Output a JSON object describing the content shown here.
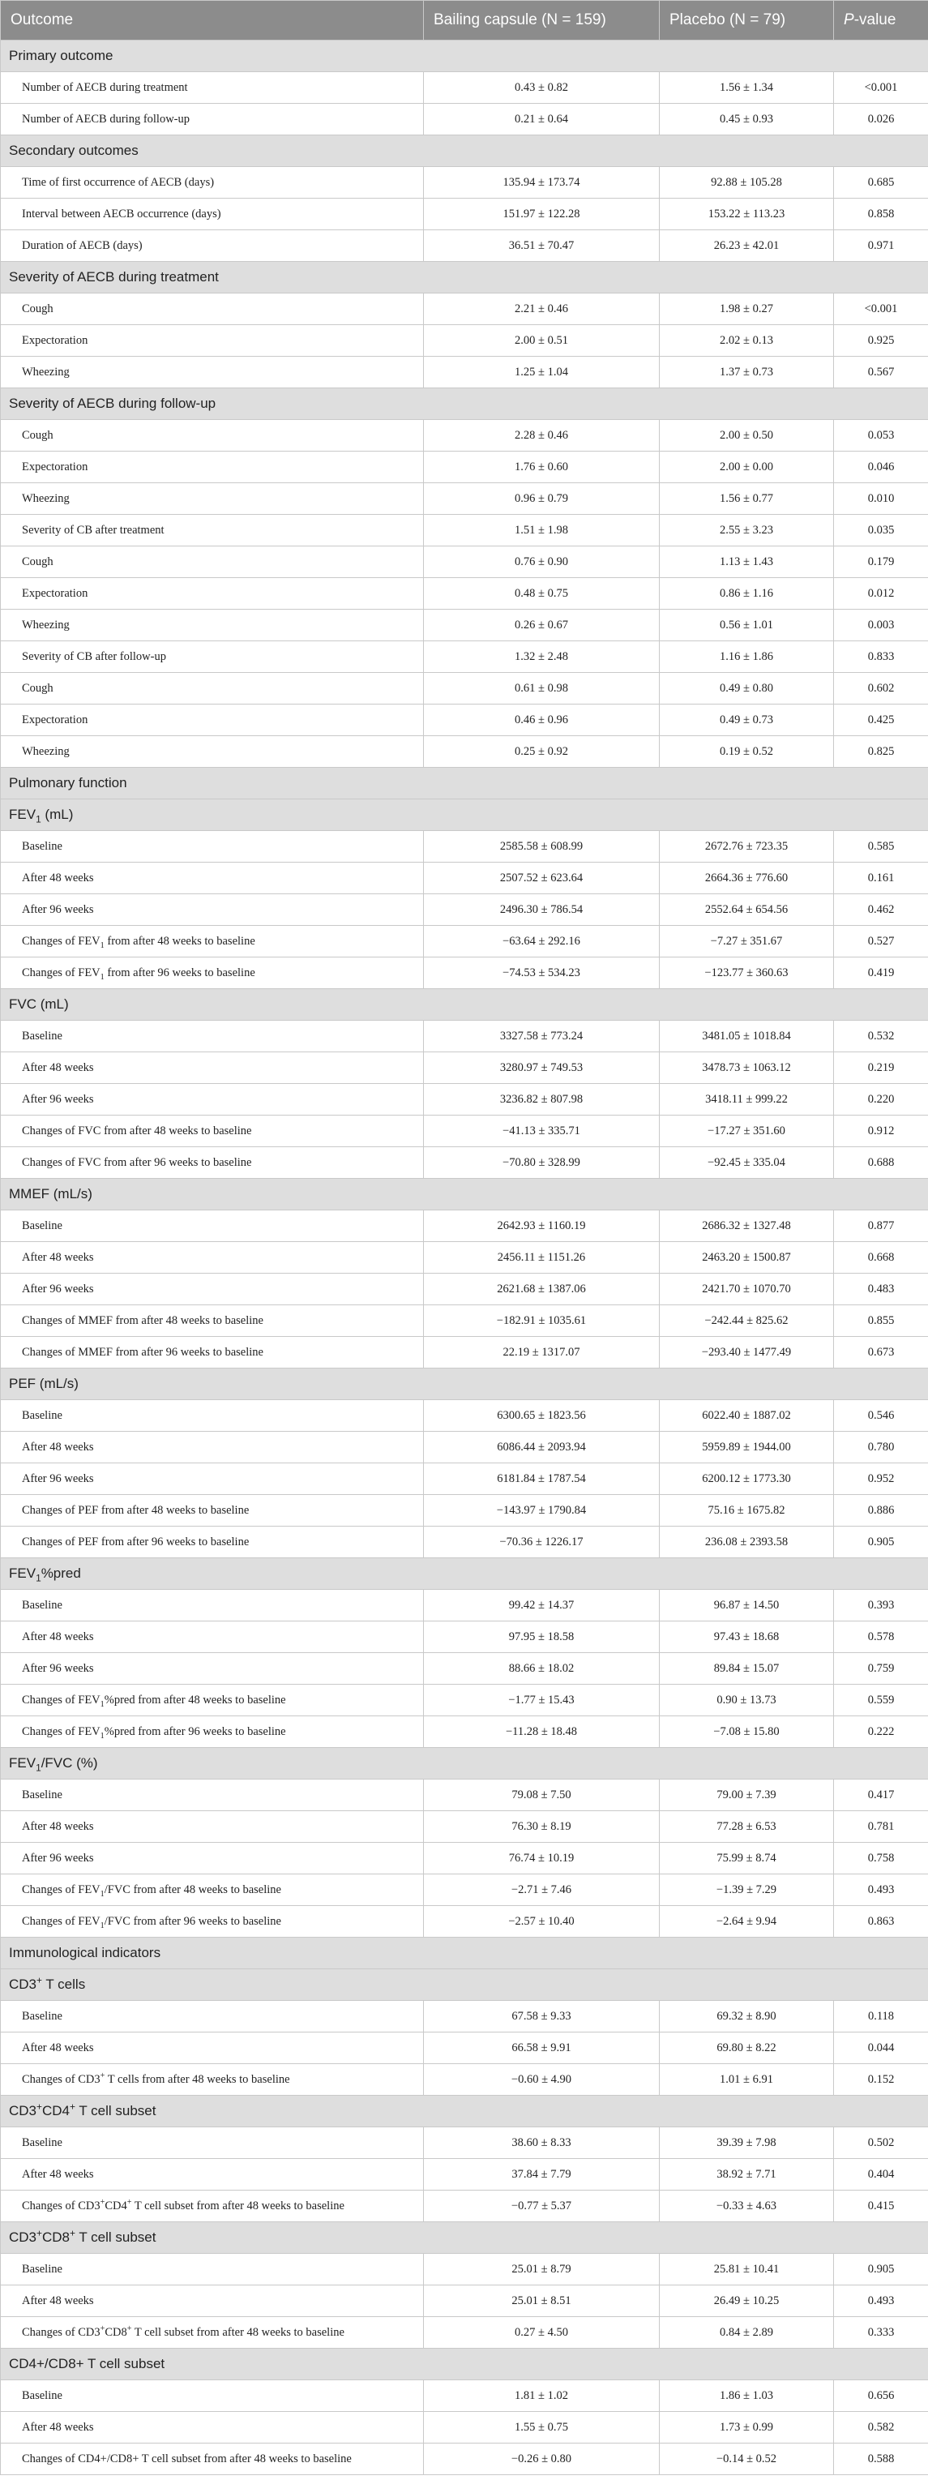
{
  "header": {
    "outcome": "Outcome",
    "bailing": "Bailing capsule (N = 159)",
    "placebo": "Placebo (N = 79)",
    "pvalue_italic": "P",
    "pvalue_rest": "-value"
  },
  "rows": [
    {
      "type": "sec",
      "label": "Primary outcome"
    },
    {
      "type": "row",
      "label": "Number of AECB during treatment",
      "bailing": "0.43 ± 0.82",
      "placebo": "1.56 ± 1.34",
      "p": "<0.001"
    },
    {
      "type": "row",
      "label": "Number of AECB during follow-up",
      "bailing": "0.21 ± 0.64",
      "placebo": "0.45 ± 0.93",
      "p": "0.026"
    },
    {
      "type": "sec",
      "label": "Secondary outcomes"
    },
    {
      "type": "row",
      "label": "Time of first occurrence of AECB (days)",
      "bailing": "135.94 ± 173.74",
      "placebo": "92.88 ± 105.28",
      "p": "0.685"
    },
    {
      "type": "row",
      "label": "Interval between AECB occurrence (days)",
      "bailing": "151.97 ± 122.28",
      "placebo": "153.22 ± 113.23",
      "p": "0.858"
    },
    {
      "type": "row",
      "label": "Duration of AECB (days)",
      "bailing": "36.51 ± 70.47",
      "placebo": "26.23 ± 42.01",
      "p": "0.971"
    },
    {
      "type": "sec",
      "label": "Severity of AECB during treatment"
    },
    {
      "type": "row",
      "label": "Cough",
      "bailing": "2.21 ± 0.46",
      "placebo": "1.98 ± 0.27",
      "p": "<0.001"
    },
    {
      "type": "row",
      "label": "Expectoration",
      "bailing": "2.00 ± 0.51",
      "placebo": "2.02 ± 0.13",
      "p": "0.925"
    },
    {
      "type": "row",
      "label": "Wheezing",
      "bailing": "1.25 ± 1.04",
      "placebo": "1.37 ± 0.73",
      "p": "0.567"
    },
    {
      "type": "sec",
      "label": "Severity of AECB during follow-up"
    },
    {
      "type": "row",
      "label": "Cough",
      "bailing": "2.28 ± 0.46",
      "placebo": "2.00 ± 0.50",
      "p": "0.053"
    },
    {
      "type": "row",
      "label": "Expectoration",
      "bailing": "1.76 ± 0.60",
      "placebo": "2.00 ± 0.00",
      "p": "0.046"
    },
    {
      "type": "row",
      "label": "Wheezing",
      "bailing": "0.96 ± 0.79",
      "placebo": "1.56 ± 0.77",
      "p": "0.010"
    },
    {
      "type": "row",
      "label": "Severity of CB after treatment",
      "bailing": "1.51 ± 1.98",
      "placebo": "2.55 ± 3.23",
      "p": "0.035"
    },
    {
      "type": "row",
      "label": "Cough",
      "bailing": "0.76 ± 0.90",
      "placebo": "1.13 ± 1.43",
      "p": "0.179"
    },
    {
      "type": "row",
      "label": "Expectoration",
      "bailing": "0.48 ± 0.75",
      "placebo": "0.86 ± 1.16",
      "p": "0.012"
    },
    {
      "type": "row",
      "label": "Wheezing",
      "bailing": "0.26 ± 0.67",
      "placebo": "0.56 ± 1.01",
      "p": "0.003"
    },
    {
      "type": "row",
      "label": "Severity of CB after follow-up",
      "bailing": "1.32 ± 2.48",
      "placebo": "1.16 ± 1.86",
      "p": "0.833"
    },
    {
      "type": "row",
      "label": "Cough",
      "bailing": "0.61 ± 0.98",
      "placebo": "0.49 ± 0.80",
      "p": "0.602"
    },
    {
      "type": "row",
      "label": "Expectoration",
      "bailing": "0.46 ± 0.96",
      "placebo": "0.49 ± 0.73",
      "p": "0.425"
    },
    {
      "type": "row",
      "label": "Wheezing",
      "bailing": "0.25 ± 0.92",
      "placebo": "0.19 ± 0.52",
      "p": "0.825"
    },
    {
      "type": "sec",
      "label": "Pulmonary function"
    },
    {
      "type": "sec",
      "label": "FEV<sub>1</sub> (mL)"
    },
    {
      "type": "row",
      "label": "Baseline",
      "bailing": "2585.58 ± 608.99",
      "placebo": "2672.76 ± 723.35",
      "p": "0.585"
    },
    {
      "type": "row",
      "label": "After 48 weeks",
      "bailing": "2507.52 ± 623.64",
      "placebo": "2664.36 ± 776.60",
      "p": "0.161"
    },
    {
      "type": "row",
      "label": "After 96 weeks",
      "bailing": "2496.30 ± 786.54",
      "placebo": "2552.64 ± 654.56",
      "p": "0.462"
    },
    {
      "type": "row",
      "label": "Changes of FEV<sub>1</sub> from after 48 weeks to baseline",
      "bailing": "−63.64 ± 292.16",
      "placebo": "−7.27 ± 351.67",
      "p": "0.527"
    },
    {
      "type": "row",
      "label": "Changes of FEV<sub>1</sub> from after 96 weeks to baseline",
      "bailing": "−74.53 ± 534.23",
      "placebo": "−123.77 ± 360.63",
      "p": "0.419"
    },
    {
      "type": "sec",
      "label": "FVC (mL)"
    },
    {
      "type": "row",
      "label": "Baseline",
      "bailing": "3327.58 ± 773.24",
      "placebo": "3481.05 ± 1018.84",
      "p": "0.532"
    },
    {
      "type": "row",
      "label": "After 48 weeks",
      "bailing": "3280.97 ± 749.53",
      "placebo": "3478.73 ± 1063.12",
      "p": "0.219"
    },
    {
      "type": "row",
      "label": "After 96 weeks",
      "bailing": "3236.82 ± 807.98",
      "placebo": "3418.11 ± 999.22",
      "p": "0.220"
    },
    {
      "type": "row",
      "label": "Changes of FVC from after 48 weeks to baseline",
      "bailing": "−41.13 ± 335.71",
      "placebo": "−17.27 ± 351.60",
      "p": "0.912"
    },
    {
      "type": "row",
      "label": "Changes of FVC from after 96 weeks to baseline",
      "bailing": "−70.80 ± 328.99",
      "placebo": "−92.45 ± 335.04",
      "p": "0.688"
    },
    {
      "type": "sec",
      "label": "MMEF (mL/s)"
    },
    {
      "type": "row",
      "label": "Baseline",
      "bailing": "2642.93 ± 1160.19",
      "placebo": "2686.32 ± 1327.48",
      "p": "0.877"
    },
    {
      "type": "row",
      "label": "After 48 weeks",
      "bailing": "2456.11 ± 1151.26",
      "placebo": "2463.20 ± 1500.87",
      "p": "0.668"
    },
    {
      "type": "row",
      "label": "After 96 weeks",
      "bailing": "2621.68 ± 1387.06",
      "placebo": "2421.70 ± 1070.70",
      "p": "0.483"
    },
    {
      "type": "row",
      "label": "Changes of MMEF from after 48 weeks to baseline",
      "bailing": "−182.91 ± 1035.61",
      "placebo": "−242.44 ± 825.62",
      "p": "0.855"
    },
    {
      "type": "row",
      "label": "Changes of MMEF from after 96 weeks to baseline",
      "bailing": "22.19 ± 1317.07",
      "placebo": "−293.40 ± 1477.49",
      "p": "0.673"
    },
    {
      "type": "sec",
      "label": "PEF (mL/s)"
    },
    {
      "type": "row",
      "label": "Baseline",
      "bailing": "6300.65 ± 1823.56",
      "placebo": "6022.40 ± 1887.02",
      "p": "0.546"
    },
    {
      "type": "row",
      "label": "After 48 weeks",
      "bailing": "6086.44 ± 2093.94",
      "placebo": "5959.89 ± 1944.00",
      "p": "0.780"
    },
    {
      "type": "row",
      "label": "After 96 weeks",
      "bailing": "6181.84 ± 1787.54",
      "placebo": "6200.12 ± 1773.30",
      "p": "0.952"
    },
    {
      "type": "row",
      "label": "Changes of PEF from after 48 weeks to baseline",
      "bailing": "−143.97 ± 1790.84",
      "placebo": "75.16 ± 1675.82",
      "p": "0.886"
    },
    {
      "type": "row",
      "label": "Changes of PEF from after 96 weeks to baseline",
      "bailing": "−70.36 ± 1226.17",
      "placebo": "236.08 ± 2393.58",
      "p": "0.905"
    },
    {
      "type": "sec",
      "label": "FEV<sub>1</sub>%pred"
    },
    {
      "type": "row",
      "label": "Baseline",
      "bailing": "99.42 ± 14.37",
      "placebo": "96.87 ± 14.50",
      "p": "0.393"
    },
    {
      "type": "row",
      "label": "After 48 weeks",
      "bailing": "97.95 ± 18.58",
      "placebo": "97.43 ± 18.68",
      "p": "0.578"
    },
    {
      "type": "row",
      "label": "After 96 weeks",
      "bailing": "88.66 ± 18.02",
      "placebo": "89.84 ± 15.07",
      "p": "0.759"
    },
    {
      "type": "row",
      "label": "Changes of FEV<sub>1</sub>%pred from after 48 weeks to baseline",
      "bailing": "−1.77 ± 15.43",
      "placebo": "0.90 ± 13.73",
      "p": "0.559"
    },
    {
      "type": "row",
      "label": "Changes of FEV<sub>1</sub>%pred from after 96 weeks to baseline",
      "bailing": "−11.28 ± 18.48",
      "placebo": "−7.08 ± 15.80",
      "p": "0.222"
    },
    {
      "type": "sec",
      "label": "FEV<sub>1</sub>/FVC (%)"
    },
    {
      "type": "row",
      "label": "Baseline",
      "bailing": "79.08 ± 7.50",
      "placebo": "79.00 ± 7.39",
      "p": "0.417"
    },
    {
      "type": "row",
      "label": "After 48 weeks",
      "bailing": "76.30 ± 8.19",
      "placebo": "77.28 ± 6.53",
      "p": "0.781"
    },
    {
      "type": "row",
      "label": "After 96 weeks",
      "bailing": "76.74 ± 10.19",
      "placebo": "75.99 ± 8.74",
      "p": "0.758"
    },
    {
      "type": "row",
      "label": "Changes of FEV<sub>1</sub>/FVC from after 48 weeks to baseline",
      "bailing": "−2.71 ± 7.46",
      "placebo": "−1.39 ± 7.29",
      "p": "0.493"
    },
    {
      "type": "row",
      "label": "Changes of FEV<sub>1</sub>/FVC from after 96 weeks to baseline",
      "bailing": "−2.57 ± 10.40",
      "placebo": "−2.64 ± 9.94",
      "p": "0.863"
    },
    {
      "type": "sec",
      "label": "Immunological indicators"
    },
    {
      "type": "sec",
      "label": "CD3<sup>+</sup> T cells"
    },
    {
      "type": "row",
      "label": "Baseline",
      "bailing": "67.58 ± 9.33",
      "placebo": "69.32 ± 8.90",
      "p": "0.118"
    },
    {
      "type": "row",
      "label": "After 48 weeks",
      "bailing": "66.58 ± 9.91",
      "placebo": "69.80 ± 8.22",
      "p": "0.044"
    },
    {
      "type": "row",
      "label": "Changes of CD3<sup>+</sup> T cells from after 48 weeks to baseline",
      "bailing": "−0.60 ± 4.90",
      "placebo": "1.01 ± 6.91",
      "p": "0.152"
    },
    {
      "type": "sec",
      "label": "CD3<sup>+</sup>CD4<sup>+</sup> T cell subset"
    },
    {
      "type": "row",
      "label": "Baseline",
      "bailing": "38.60 ± 8.33",
      "placebo": "39.39 ± 7.98",
      "p": "0.502"
    },
    {
      "type": "row",
      "label": "After 48 weeks",
      "bailing": "37.84 ± 7.79",
      "placebo": "38.92 ± 7.71",
      "p": "0.404"
    },
    {
      "type": "row",
      "label": "Changes of CD3<sup>+</sup>CD4<sup>+</sup> T cell subset from after 48 weeks to baseline",
      "bailing": "−0.77 ± 5.37",
      "placebo": "−0.33 ± 4.63",
      "p": "0.415"
    },
    {
      "type": "sec",
      "label": "CD3<sup>+</sup>CD8<sup>+</sup> T cell subset"
    },
    {
      "type": "row",
      "label": "Baseline",
      "bailing": "25.01 ± 8.79",
      "placebo": "25.81 ± 10.41",
      "p": "0.905"
    },
    {
      "type": "row",
      "label": "After 48 weeks",
      "bailing": "25.01 ± 8.51",
      "placebo": "26.49 ± 10.25",
      "p": "0.493"
    },
    {
      "type": "row",
      "label": "Changes of CD3<sup>+</sup>CD8<sup>+</sup> T cell subset from after 48 weeks to baseline",
      "bailing": "0.27 ± 4.50",
      "placebo": "0.84 ± 2.89",
      "p": "0.333"
    },
    {
      "type": "sec",
      "label": "CD4+/CD8+ T cell subset"
    },
    {
      "type": "row",
      "label": "Baseline",
      "bailing": "1.81 ± 1.02",
      "placebo": "1.86 ± 1.03",
      "p": "0.656"
    },
    {
      "type": "row",
      "label": "After 48 weeks",
      "bailing": "1.55 ± 0.75",
      "placebo": "1.73 ± 0.99",
      "p": "0.582"
    },
    {
      "type": "row",
      "label": "Changes of CD4+/CD8+ T cell subset from after 48 weeks to baseline",
      "bailing": "−0.26 ± 0.80",
      "placebo": "−0.14 ± 0.52",
      "p": "0.588"
    }
  ]
}
